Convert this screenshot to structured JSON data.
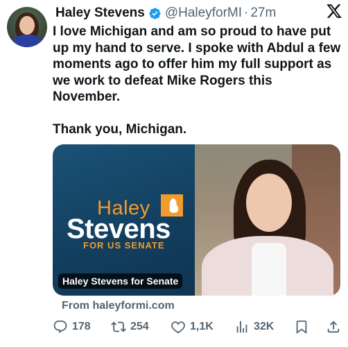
{
  "author": {
    "name": "Haley Stevens",
    "handle": "@HaleyforMI",
    "separator": "·",
    "time": "27m"
  },
  "tweet": {
    "text": "I love Michigan and am so proud to have put up my hand to serve. I spoke with Abdul a few moments ago to offer him my full support as we work to defeat Mike Rogers this November.\n\nThank you, Michigan."
  },
  "card": {
    "logo_top": "Haley",
    "logo_main": "Stevens",
    "logo_sub": "FOR US SENATE",
    "label": "Haley Stevens for Senate",
    "from": "From haleyformi.com"
  },
  "actions": {
    "replies": "178",
    "reposts": "254",
    "likes": "1,1K",
    "views": "32K"
  },
  "colors": {
    "verified": "#1d9bf0",
    "brand_orange": "#f39b2f",
    "card_blue": "#123e5e"
  },
  "icons": [
    "verified-icon",
    "x-logo-icon",
    "reply-icon",
    "repost-icon",
    "like-icon",
    "views-icon",
    "bookmark-icon",
    "share-icon"
  ]
}
